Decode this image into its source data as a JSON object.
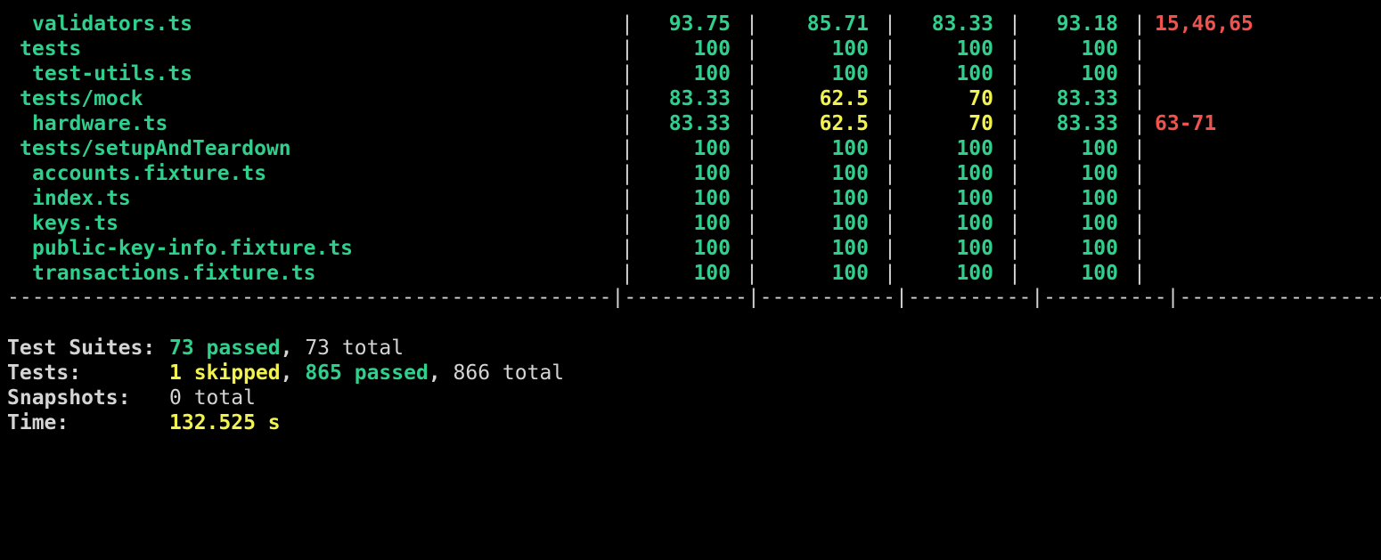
{
  "colors": {
    "background": "#000000",
    "green": "#2fcf8c",
    "yellow": "#f2f24f",
    "red": "#f0524e",
    "text": "#d4d4d4"
  },
  "pipe": "|",
  "rows": [
    {
      "file": "validators.ts",
      "stmts": "93.75",
      "branch": "85.71",
      "funcs": "83.33",
      "lines": "93.18",
      "uncovered": "15,46,65"
    },
    {
      "file": "tests",
      "stmts": "100",
      "branch": "100",
      "funcs": "100",
      "lines": "100",
      "uncovered": ""
    },
    {
      "file": "test-utils.ts",
      "stmts": "100",
      "branch": "100",
      "funcs": "100",
      "lines": "100",
      "uncovered": ""
    },
    {
      "file": "tests/mock",
      "stmts": "83.33",
      "branch": "62.5",
      "funcs": "70",
      "lines": "83.33",
      "uncovered": ""
    },
    {
      "file": "hardware.ts",
      "stmts": "83.33",
      "branch": "62.5",
      "funcs": "70",
      "lines": "83.33",
      "uncovered": "63-71"
    },
    {
      "file": "tests/setupAndTeardown",
      "stmts": "100",
      "branch": "100",
      "funcs": "100",
      "lines": "100",
      "uncovered": ""
    },
    {
      "file": "accounts.fixture.ts",
      "stmts": "100",
      "branch": "100",
      "funcs": "100",
      "lines": "100",
      "uncovered": ""
    },
    {
      "file": "index.ts",
      "stmts": "100",
      "branch": "100",
      "funcs": "100",
      "lines": "100",
      "uncovered": ""
    },
    {
      "file": "keys.ts",
      "stmts": "100",
      "branch": "100",
      "funcs": "100",
      "lines": "100",
      "uncovered": ""
    },
    {
      "file": "public-key-info.fixture.ts",
      "stmts": "100",
      "branch": "100",
      "funcs": "100",
      "lines": "100",
      "uncovered": ""
    },
    {
      "file": "transactions.fixture.ts",
      "stmts": "100",
      "branch": "100",
      "funcs": "100",
      "lines": "100",
      "uncovered": ""
    }
  ],
  "separator": "-------------------------------------------------|----------|-----------|----------|----------|-------------------",
  "summary": {
    "suites": {
      "label": "Test Suites:",
      "passed": "73 passed",
      "comma": ", ",
      "total": "73 total"
    },
    "tests": {
      "label": "Tests:",
      "skipped": "1 skipped",
      "comma1": ", ",
      "passed": "865 passed",
      "comma2": ", ",
      "total": "866 total"
    },
    "snapshots": {
      "label": "Snapshots:",
      "total": "0 total"
    },
    "time": {
      "label": "Time:",
      "value": "132.525 s"
    }
  }
}
